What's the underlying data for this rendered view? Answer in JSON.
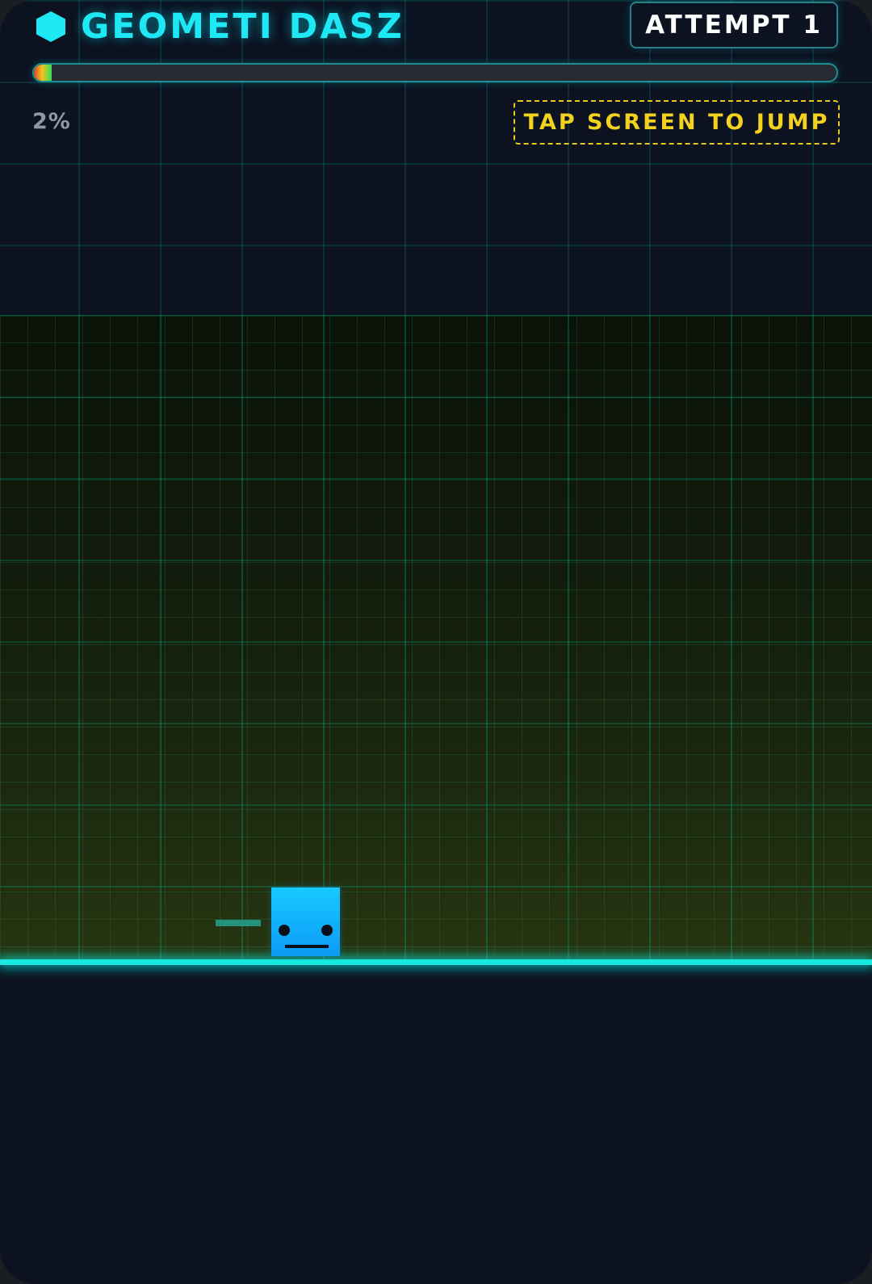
{
  "game": {
    "title": "GEOMETI DASZ",
    "attempt_label": "ATTEMPT 1",
    "instruction": "TAP SCREEN TO JUMP"
  },
  "progress": {
    "percent_text": "2%",
    "fraction": 0.02
  },
  "player": {
    "shape": "square-cube",
    "face": "neutral"
  },
  "icons": {
    "logo": "hexagon-icon"
  },
  "colors": {
    "accent_cyan": "#1ee8f4",
    "ground_line": "#19e8e0",
    "hint_yellow": "#f3d21f",
    "player_blue": "#0b9bf6",
    "background": "#0c1220",
    "progress_gradient": [
      "#e3402a",
      "#f6c21b",
      "#34e05a"
    ]
  }
}
